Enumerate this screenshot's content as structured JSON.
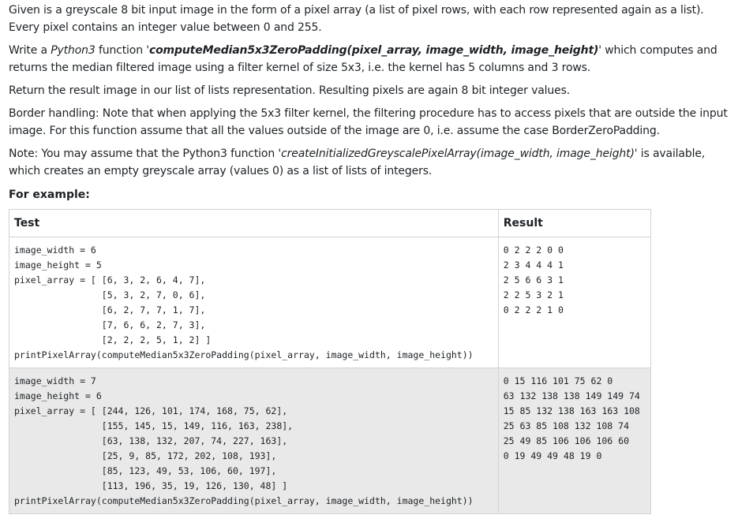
{
  "intro": {
    "p1": "Given is a greyscale 8 bit input image in the form of a pixel array (a list of pixel rows, with each row represented again as a list). Every pixel contains an integer value between 0 and 255.",
    "p2_prefix": "Write a ",
    "p2_lang": "Python3",
    "p2_mid": " function '",
    "p2_func": "computeMedian5x3ZeroPadding(pixel_array, image_width, image_height)",
    "p2_suffix": "' which computes and returns the median filtered image using a filter kernel of size 5x3, i.e. the kernel has 5 columns and 3 rows.",
    "p3": "Return the result image in our list of lists representation. Resulting pixels are again 8 bit integer values.",
    "p4": "Border handling: Note that when applying the 5x3 filter kernel, the filtering procedure has to access pixels that are outside the input image. For this function assume that all the values outside of the image are 0, i.e. assume the case BorderZeroPadding.",
    "p5_prefix": "Note: You may assume that the Python3 function '",
    "p5_func": "createInitializedGreyscalePixelArray(image_width, image_height)",
    "p5_suffix": "' is available, which creates an empty greyscale array (values 0) as a list of lists of integers.",
    "example_heading": "For example:"
  },
  "table": {
    "headers": {
      "test": "Test",
      "result": "Result"
    },
    "rows": [
      {
        "test": "image_width = 6\nimage_height = 5\npixel_array = [ [6, 3, 2, 6, 4, 7],\n                [5, 3, 2, 7, 0, 6],\n                [6, 2, 7, 7, 1, 7],\n                [7, 6, 6, 2, 7, 3],\n                [2, 2, 2, 5, 1, 2] ]\nprintPixelArray(computeMedian5x3ZeroPadding(pixel_array, image_width, image_height))",
        "result": "0 2 2 2 0 0\n2 3 4 4 4 1\n2 5 6 6 3 1\n2 2 5 3 2 1\n0 2 2 2 1 0"
      },
      {
        "test": "image_width = 7\nimage_height = 6\npixel_array = [ [244, 126, 101, 174, 168, 75, 62],\n                [155, 145, 15, 149, 116, 163, 238],\n                [63, 138, 132, 207, 74, 227, 163],\n                [25, 9, 85, 172, 202, 108, 193],\n                [85, 123, 49, 53, 106, 60, 197],\n                [113, 196, 35, 19, 126, 130, 48] ]\nprintPixelArray(computeMedian5x3ZeroPadding(pixel_array, image_width, image_height))",
        "result": "0 15 116 101 75 62 0\n63 132 138 138 149 149 74\n15 85 132 138 163 163 108\n25 63 85 108 132 108 74\n25 49 85 106 106 106 60\n0 19 49 49 48 19 0"
      }
    ]
  }
}
